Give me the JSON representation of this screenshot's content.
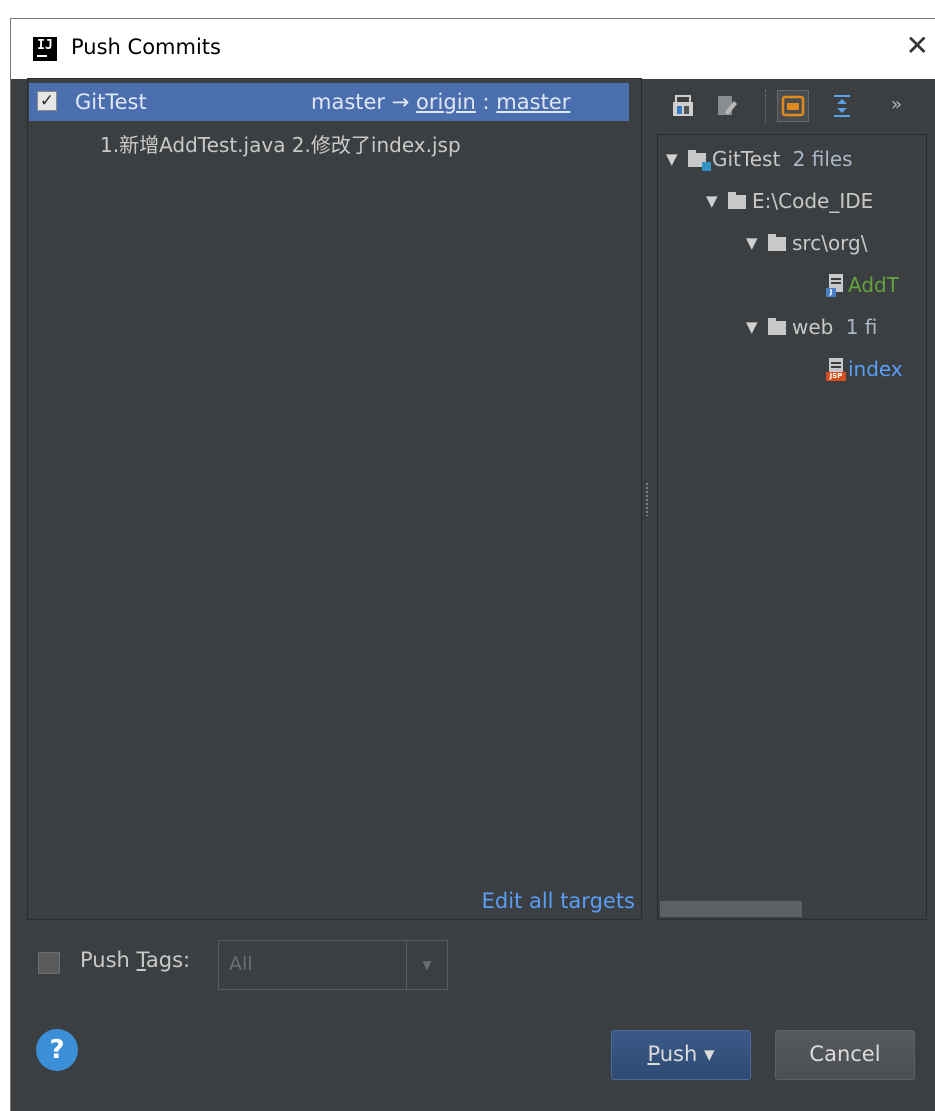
{
  "window": {
    "title": "Push Commits"
  },
  "left_panel": {
    "repository": {
      "name": "GitTest",
      "checked": true,
      "local_branch": "master",
      "arrow": "→",
      "remote": "origin",
      "separator": ":",
      "remote_branch": "master"
    },
    "commit": {
      "message": "1.新增AddTest.java 2.修改了index.jsp"
    },
    "edit_all_targets": "Edit all targets"
  },
  "right_panel": {
    "toolbar_more": "»",
    "tree": [
      {
        "label": "GitTest",
        "suffix": "2 files"
      },
      {
        "label": "E:\\Code_IDE"
      },
      {
        "label": "src\\org\\"
      },
      {
        "label": "AddT",
        "color": "#62a33c"
      },
      {
        "label": "web",
        "suffix": "1 fi"
      },
      {
        "label": "index",
        "color": "#589df6"
      }
    ]
  },
  "push_tags": {
    "label_before": "Push ",
    "mnemonic": "T",
    "label_after": "ags:",
    "checked": false,
    "selected_value": "All"
  },
  "buttons": {
    "push": {
      "mnemonic": "P",
      "rest": "ush",
      "dropdown": "▾"
    },
    "cancel": "Cancel",
    "help": "?"
  },
  "colors": {
    "selection": "#4b6eaf",
    "link": "#589df6",
    "added_file": "#62a33c",
    "modified_file": "#589df6",
    "background": "#3c3f41"
  }
}
